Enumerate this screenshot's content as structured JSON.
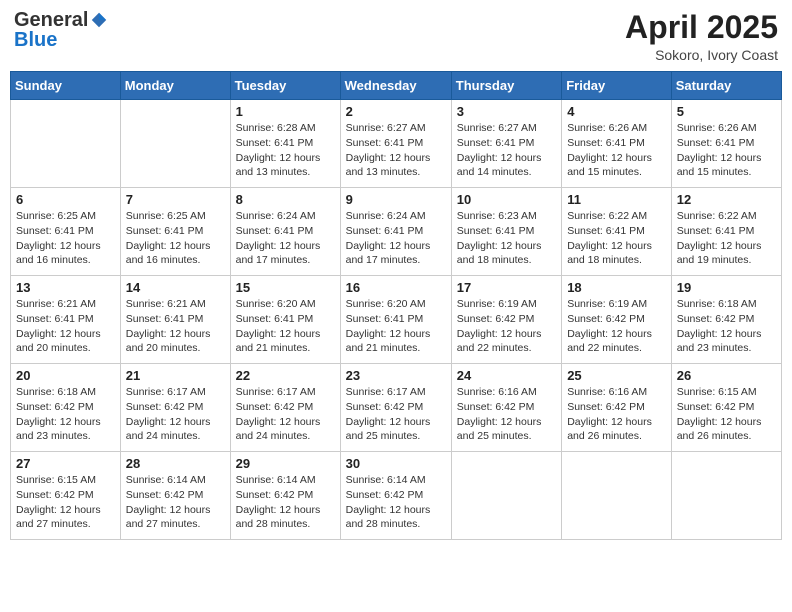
{
  "header": {
    "logo_general": "General",
    "logo_blue": "Blue",
    "month_title": "April 2025",
    "location": "Sokoro, Ivory Coast"
  },
  "days_of_week": [
    "Sunday",
    "Monday",
    "Tuesday",
    "Wednesday",
    "Thursday",
    "Friday",
    "Saturday"
  ],
  "weeks": [
    [
      {
        "day": "",
        "sunrise": "",
        "sunset": "",
        "daylight": ""
      },
      {
        "day": "",
        "sunrise": "",
        "sunset": "",
        "daylight": ""
      },
      {
        "day": "1",
        "sunrise": "Sunrise: 6:28 AM",
        "sunset": "Sunset: 6:41 PM",
        "daylight": "Daylight: 12 hours and 13 minutes."
      },
      {
        "day": "2",
        "sunrise": "Sunrise: 6:27 AM",
        "sunset": "Sunset: 6:41 PM",
        "daylight": "Daylight: 12 hours and 13 minutes."
      },
      {
        "day": "3",
        "sunrise": "Sunrise: 6:27 AM",
        "sunset": "Sunset: 6:41 PM",
        "daylight": "Daylight: 12 hours and 14 minutes."
      },
      {
        "day": "4",
        "sunrise": "Sunrise: 6:26 AM",
        "sunset": "Sunset: 6:41 PM",
        "daylight": "Daylight: 12 hours and 15 minutes."
      },
      {
        "day": "5",
        "sunrise": "Sunrise: 6:26 AM",
        "sunset": "Sunset: 6:41 PM",
        "daylight": "Daylight: 12 hours and 15 minutes."
      }
    ],
    [
      {
        "day": "6",
        "sunrise": "Sunrise: 6:25 AM",
        "sunset": "Sunset: 6:41 PM",
        "daylight": "Daylight: 12 hours and 16 minutes."
      },
      {
        "day": "7",
        "sunrise": "Sunrise: 6:25 AM",
        "sunset": "Sunset: 6:41 PM",
        "daylight": "Daylight: 12 hours and 16 minutes."
      },
      {
        "day": "8",
        "sunrise": "Sunrise: 6:24 AM",
        "sunset": "Sunset: 6:41 PM",
        "daylight": "Daylight: 12 hours and 17 minutes."
      },
      {
        "day": "9",
        "sunrise": "Sunrise: 6:24 AM",
        "sunset": "Sunset: 6:41 PM",
        "daylight": "Daylight: 12 hours and 17 minutes."
      },
      {
        "day": "10",
        "sunrise": "Sunrise: 6:23 AM",
        "sunset": "Sunset: 6:41 PM",
        "daylight": "Daylight: 12 hours and 18 minutes."
      },
      {
        "day": "11",
        "sunrise": "Sunrise: 6:22 AM",
        "sunset": "Sunset: 6:41 PM",
        "daylight": "Daylight: 12 hours and 18 minutes."
      },
      {
        "day": "12",
        "sunrise": "Sunrise: 6:22 AM",
        "sunset": "Sunset: 6:41 PM",
        "daylight": "Daylight: 12 hours and 19 minutes."
      }
    ],
    [
      {
        "day": "13",
        "sunrise": "Sunrise: 6:21 AM",
        "sunset": "Sunset: 6:41 PM",
        "daylight": "Daylight: 12 hours and 20 minutes."
      },
      {
        "day": "14",
        "sunrise": "Sunrise: 6:21 AM",
        "sunset": "Sunset: 6:41 PM",
        "daylight": "Daylight: 12 hours and 20 minutes."
      },
      {
        "day": "15",
        "sunrise": "Sunrise: 6:20 AM",
        "sunset": "Sunset: 6:41 PM",
        "daylight": "Daylight: 12 hours and 21 minutes."
      },
      {
        "day": "16",
        "sunrise": "Sunrise: 6:20 AM",
        "sunset": "Sunset: 6:41 PM",
        "daylight": "Daylight: 12 hours and 21 minutes."
      },
      {
        "day": "17",
        "sunrise": "Sunrise: 6:19 AM",
        "sunset": "Sunset: 6:42 PM",
        "daylight": "Daylight: 12 hours and 22 minutes."
      },
      {
        "day": "18",
        "sunrise": "Sunrise: 6:19 AM",
        "sunset": "Sunset: 6:42 PM",
        "daylight": "Daylight: 12 hours and 22 minutes."
      },
      {
        "day": "19",
        "sunrise": "Sunrise: 6:18 AM",
        "sunset": "Sunset: 6:42 PM",
        "daylight": "Daylight: 12 hours and 23 minutes."
      }
    ],
    [
      {
        "day": "20",
        "sunrise": "Sunrise: 6:18 AM",
        "sunset": "Sunset: 6:42 PM",
        "daylight": "Daylight: 12 hours and 23 minutes."
      },
      {
        "day": "21",
        "sunrise": "Sunrise: 6:17 AM",
        "sunset": "Sunset: 6:42 PM",
        "daylight": "Daylight: 12 hours and 24 minutes."
      },
      {
        "day": "22",
        "sunrise": "Sunrise: 6:17 AM",
        "sunset": "Sunset: 6:42 PM",
        "daylight": "Daylight: 12 hours and 24 minutes."
      },
      {
        "day": "23",
        "sunrise": "Sunrise: 6:17 AM",
        "sunset": "Sunset: 6:42 PM",
        "daylight": "Daylight: 12 hours and 25 minutes."
      },
      {
        "day": "24",
        "sunrise": "Sunrise: 6:16 AM",
        "sunset": "Sunset: 6:42 PM",
        "daylight": "Daylight: 12 hours and 25 minutes."
      },
      {
        "day": "25",
        "sunrise": "Sunrise: 6:16 AM",
        "sunset": "Sunset: 6:42 PM",
        "daylight": "Daylight: 12 hours and 26 minutes."
      },
      {
        "day": "26",
        "sunrise": "Sunrise: 6:15 AM",
        "sunset": "Sunset: 6:42 PM",
        "daylight": "Daylight: 12 hours and 26 minutes."
      }
    ],
    [
      {
        "day": "27",
        "sunrise": "Sunrise: 6:15 AM",
        "sunset": "Sunset: 6:42 PM",
        "daylight": "Daylight: 12 hours and 27 minutes."
      },
      {
        "day": "28",
        "sunrise": "Sunrise: 6:14 AM",
        "sunset": "Sunset: 6:42 PM",
        "daylight": "Daylight: 12 hours and 27 minutes."
      },
      {
        "day": "29",
        "sunrise": "Sunrise: 6:14 AM",
        "sunset": "Sunset: 6:42 PM",
        "daylight": "Daylight: 12 hours and 28 minutes."
      },
      {
        "day": "30",
        "sunrise": "Sunrise: 6:14 AM",
        "sunset": "Sunset: 6:42 PM",
        "daylight": "Daylight: 12 hours and 28 minutes."
      },
      {
        "day": "",
        "sunrise": "",
        "sunset": "",
        "daylight": ""
      },
      {
        "day": "",
        "sunrise": "",
        "sunset": "",
        "daylight": ""
      },
      {
        "day": "",
        "sunrise": "",
        "sunset": "",
        "daylight": ""
      }
    ]
  ]
}
